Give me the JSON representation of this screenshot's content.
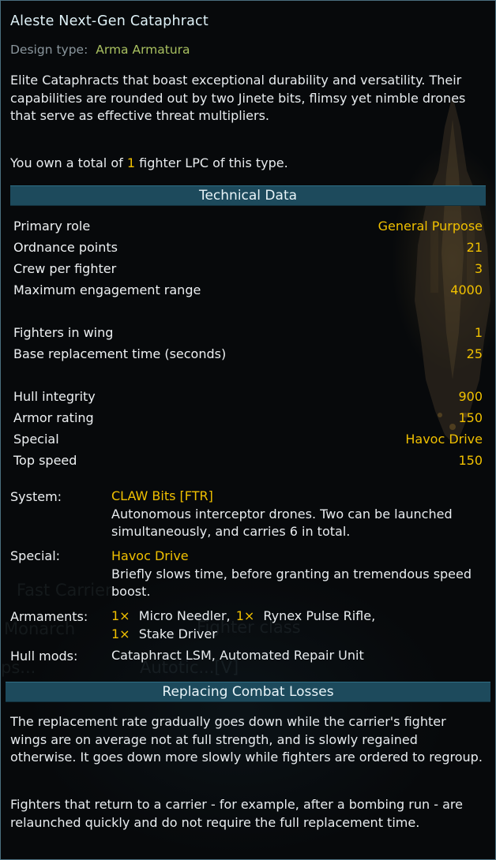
{
  "title": "Aleste Next-Gen Cataphract",
  "design_type": {
    "label": "Design type:",
    "value": "Arma Armatura"
  },
  "description": "Elite Cataphracts that boast exceptional durability and versatility. Their capabilities are rounded out by two Jinete bits, flimsy yet nimble drones that serve as effective threat multipliers.",
  "ownership": {
    "prefix": "You own a total of ",
    "count": "1",
    "suffix": " fighter LPC of this type."
  },
  "technical_data": {
    "header": "Technical Data",
    "rows": [
      {
        "label": "Primary role",
        "value": "General Purpose"
      },
      {
        "label": "Ordnance points",
        "value": "21"
      },
      {
        "label": "Crew per fighter",
        "value": "3"
      },
      {
        "label": "Maximum engagement range",
        "value": "4000"
      },
      {
        "label": "Fighters in wing",
        "value": "1"
      },
      {
        "label": "Base replacement time (seconds)",
        "value": "25"
      },
      {
        "label": "Hull integrity",
        "value": "900"
      },
      {
        "label": "Armor rating",
        "value": "150"
      },
      {
        "label": "Special",
        "value": "Havoc Drive"
      },
      {
        "label": "Top speed",
        "value": "150"
      }
    ]
  },
  "system": {
    "label": "System:",
    "name": "CLAW Bits [FTR]",
    "description": "Autonomous interceptor drones. Two can be launched simultaneously, and carries 6 in total."
  },
  "special": {
    "label": "Special:",
    "name": "Havoc Drive",
    "description": "Briefly slows time, before granting an tremendous speed boost."
  },
  "armaments": {
    "label": "Armaments:",
    "items": [
      {
        "count": "1×",
        "name": "Micro Needler,"
      },
      {
        "count": "1×",
        "name": "Rynex Pulse Rifle,"
      },
      {
        "count": "1×",
        "name": "Stake Driver"
      }
    ]
  },
  "hull_mods": {
    "label": "Hull mods:",
    "value": "Cataphract LSM, Automated Repair Unit"
  },
  "replacing": {
    "header": "Replacing Combat Losses",
    "para1": "The replacement rate gradually goes down while the carrier's fighter wings are on average not at full strength, and is slowly regained otherwise. It goes down more slowly while fighters are ordered to regroup.",
    "para2": "Fighters that return to a carrier - for example, after a bombing run - are relaunched quickly and do not require the full replacement time."
  },
  "background_text": {
    "line1": "Fast Carrier",
    "line2": "Monarch",
    "line3": "Fighter class",
    "line4": "ps...",
    "line5": "Autotic...[V]"
  },
  "colors": {
    "accent_value": "#f0c000",
    "design_type": "#a8c060",
    "header_bar": "#1d4a5c",
    "border": "#4b6f7f"
  }
}
